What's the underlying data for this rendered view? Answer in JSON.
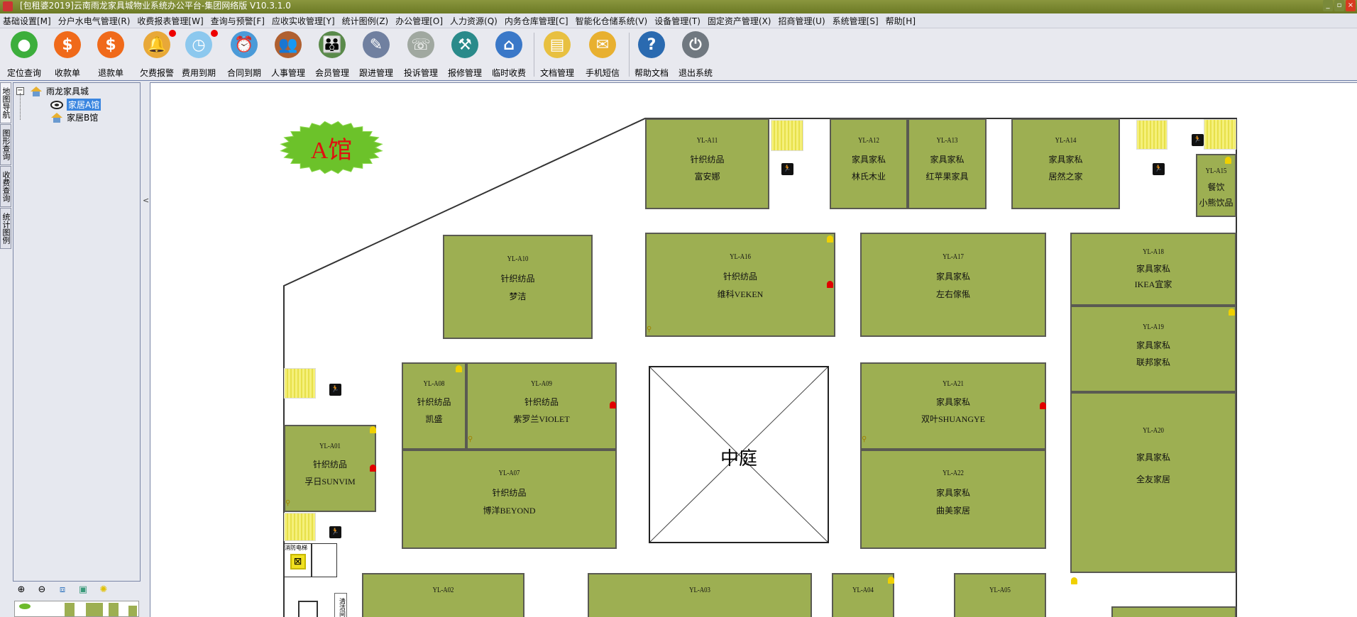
{
  "window": {
    "title": "[包租婆2019]云南雨龙家具城物业系统办公平台-集团网络版 V10.3.1.0"
  },
  "menu": [
    "基础设置[M]",
    "分户水电气管理(R)",
    "收费报表管理[W]",
    "查询与预警[F]",
    "应收实收管理[Y]",
    "统计图例(Z)",
    "办公管理[O]",
    "人力资源(Q)",
    "内务仓库管理[C]",
    "智能化仓储系统(V)",
    "设备管理(T)",
    "固定资产管理(X)",
    "招商管理(U)",
    "系统管理[S]",
    "帮助[H]"
  ],
  "toolbar": [
    {
      "label": "定位查询",
      "icon": "location-pin-icon",
      "color": "#3cae3c"
    },
    {
      "label": "收款单",
      "icon": "dollar-receive-icon",
      "color": "#f06a1a"
    },
    {
      "label": "退款单",
      "icon": "dollar-refund-icon",
      "color": "#f06a1a"
    },
    {
      "label": "欠费报警",
      "icon": "bell-icon",
      "color": "#e8a838",
      "alert": true
    },
    {
      "label": "费用到期",
      "icon": "clock-icon",
      "color": "#8cc8ee",
      "alert": true
    },
    {
      "label": "合同到期",
      "icon": "alarm-clock-icon",
      "color": "#4a9ad8"
    },
    {
      "label": "人事管理",
      "icon": "people-icon",
      "color": "#b06030"
    },
    {
      "label": "会员管理",
      "icon": "members-icon",
      "color": "#5a8a4a"
    },
    {
      "label": "跟进管理",
      "icon": "follow-up-icon",
      "color": "#7080a0"
    },
    {
      "label": "投诉管理",
      "icon": "complaint-icon",
      "color": "#a0a8a0"
    },
    {
      "label": "报修管理",
      "icon": "repair-icon",
      "color": "#2a8a8a"
    },
    {
      "label": "临时收费",
      "icon": "house-icon",
      "color": "#3a78c8"
    },
    {
      "label": "文档管理",
      "icon": "folder-icon",
      "color": "#e8c040"
    },
    {
      "label": "手机短信",
      "icon": "envelope-icon",
      "color": "#e8b030"
    },
    {
      "label": "帮助文档",
      "icon": "help-book-icon",
      "color": "#2a6ab0"
    },
    {
      "label": "退出系统",
      "icon": "power-icon",
      "color": "#707880"
    }
  ],
  "side_tabs": [
    "地图导航",
    "图形查询",
    "收费查询",
    "统计图例"
  ],
  "tree": {
    "root": "雨龙家具城",
    "children": [
      "家居A馆",
      "家居B馆"
    ],
    "selected": "家居A馆"
  },
  "map_tools": [
    "zoom-in-icon",
    "zoom-out-icon",
    "fit-icon",
    "full-extent-icon",
    "light-bulb-icon"
  ],
  "map": {
    "hall_badge": "A馆",
    "courtyard": "中庭",
    "fire_elevator": "消防电梯",
    "cleaning_room": "清洁间",
    "store_color": "#9daf52",
    "stores": [
      {
        "code": "YL-A11",
        "category": "针织纺品",
        "brand": "富安娜"
      },
      {
        "code": "YL-A12",
        "category": "家具家私",
        "brand": "林氏木业"
      },
      {
        "code": "YL-A13",
        "category": "家具家私",
        "brand": "红苹果家具"
      },
      {
        "code": "YL-A14",
        "category": "家具家私",
        "brand": "居然之家"
      },
      {
        "code": "YL-A15",
        "category": "餐饮",
        "brand": "小熊饮品"
      },
      {
        "code": "YL-A10",
        "category": "针织纺品",
        "brand": "梦洁"
      },
      {
        "code": "YL-A16",
        "category": "针织纺品",
        "brand": "维科VEKEN"
      },
      {
        "code": "YL-A17",
        "category": "家具家私",
        "brand": "左右傢俬"
      },
      {
        "code": "YL-A18",
        "category": "家具家私",
        "brand": "IKEA宜家"
      },
      {
        "code": "YL-A19",
        "category": "家具家私",
        "brand": "联邦家私"
      },
      {
        "code": "YL-A20",
        "category": "家具家私",
        "brand": "全友家居"
      },
      {
        "code": "YL-A08",
        "category": "针织纺品",
        "brand": "凯盛"
      },
      {
        "code": "YL-A09",
        "category": "针织纺品",
        "brand": "紫罗兰VIOLET"
      },
      {
        "code": "YL-A07",
        "category": "针织纺品",
        "brand": "博洋BEYOND"
      },
      {
        "code": "YL-A01",
        "category": "针织纺品",
        "brand": "孚日SUNVIM"
      },
      {
        "code": "YL-A21",
        "category": "家具家私",
        "brand": "双叶SHUANGYE"
      },
      {
        "code": "YL-A22",
        "category": "家具家私",
        "brand": "曲美家居"
      },
      {
        "code": "YL-A02"
      },
      {
        "code": "YL-A03"
      },
      {
        "code": "YL-A04"
      },
      {
        "code": "YL-A05"
      }
    ]
  }
}
